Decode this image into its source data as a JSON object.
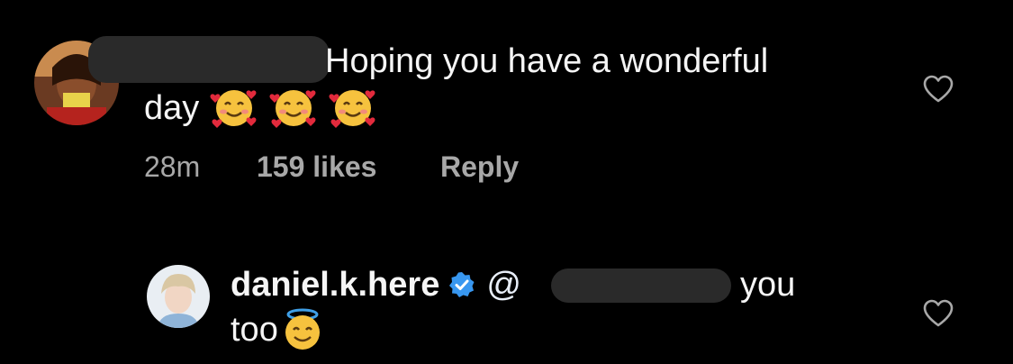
{
  "comment": {
    "text_line1": "Hoping you have a wonderful",
    "text_line2": "day",
    "emojis": [
      "smiling-face-with-hearts",
      "smiling-face-with-hearts",
      "smiling-face-with-hearts"
    ],
    "time": "28m",
    "likes": "159 likes",
    "reply_label": "Reply"
  },
  "reply": {
    "username": "daniel.k.here",
    "verified": true,
    "mention_prefix": "@",
    "text_after_mention": "you",
    "text_line2": "too",
    "emoji": "smiling-face-with-halo"
  },
  "icons": {
    "like": "heart-outline-icon",
    "verified": "verified-badge-icon"
  },
  "colors": {
    "background": "#000000",
    "text": "#f5f5f5",
    "secondary_text": "#a8a8a8",
    "verified_blue": "#3897f0",
    "redaction": "#2a2a2a"
  }
}
